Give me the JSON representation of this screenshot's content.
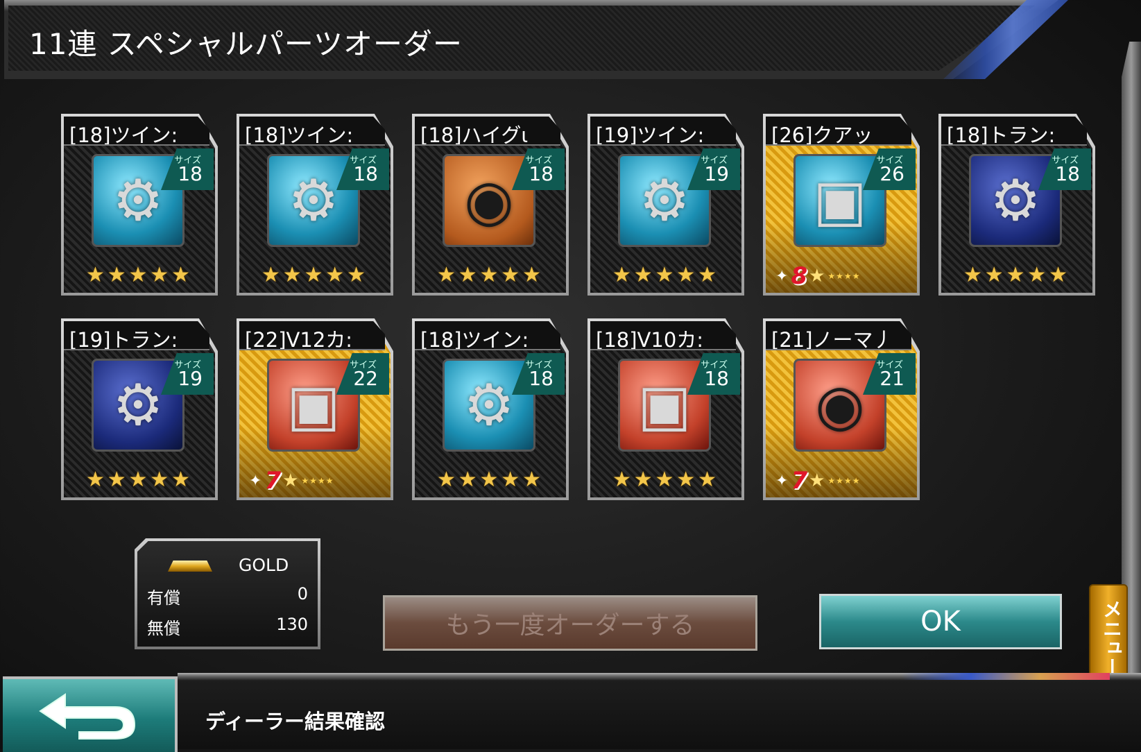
{
  "header": {
    "title": "11連 スペシャルパーツオーダー"
  },
  "parts": [
    {
      "name": "[18]ツイン:",
      "size_label": "サイズ",
      "size": "18",
      "thumb": "twin-turbo-icon",
      "bg": "teal",
      "rarity": "stars",
      "stars": 5
    },
    {
      "name": "[18]ツイン:",
      "size_label": "サイズ",
      "size": "18",
      "thumb": "twin-turbo-icon",
      "bg": "teal",
      "rarity": "stars",
      "stars": 5
    },
    {
      "name": "[18]ハイグι",
      "size_label": "サイズ",
      "size": "18",
      "thumb": "tire-icon",
      "bg": "orange",
      "rarity": "stars",
      "stars": 5
    },
    {
      "name": "[19]ツイン:",
      "size_label": "サイズ",
      "size": "19",
      "thumb": "twin-turbo-icon",
      "bg": "teal",
      "rarity": "stars",
      "stars": 5
    },
    {
      "name": "[26]クアッ",
      "size_label": "サイズ",
      "size": "26",
      "thumb": "engine-icon",
      "bg": "teal",
      "rarity": "rank",
      "rank": "8",
      "gold": true
    },
    {
      "name": "[18]トラン:",
      "size_label": "サイズ",
      "size": "18",
      "thumb": "transmission-icon",
      "bg": "navy",
      "rarity": "stars",
      "stars": 5
    },
    {
      "name": "[19]トラン:",
      "size_label": "サイズ",
      "size": "19",
      "thumb": "transmission-icon",
      "bg": "navy",
      "rarity": "stars",
      "stars": 5
    },
    {
      "name": "[22]V12カ:",
      "size_label": "サイズ",
      "size": "22",
      "thumb": "engine-icon",
      "bg": "red",
      "rarity": "rank",
      "rank": "7",
      "gold": true
    },
    {
      "name": "[18]ツイン:",
      "size_label": "サイズ",
      "size": "18",
      "thumb": "twin-turbo-icon",
      "bg": "teal",
      "rarity": "stars",
      "stars": 5
    },
    {
      "name": "[18]V10カ:",
      "size_label": "サイズ",
      "size": "18",
      "thumb": "engine-icon",
      "bg": "red",
      "rarity": "stars",
      "stars": 5
    },
    {
      "name": "[21]ノーマ丿",
      "size_label": "サイズ",
      "size": "21",
      "thumb": "tire-icon",
      "bg": "red",
      "rarity": "rank",
      "rank": "7",
      "gold": true
    }
  ],
  "gold": {
    "title": "GOLD",
    "paid_label": "有償",
    "paid_value": "0",
    "free_label": "無償",
    "free_value": "130"
  },
  "buttons": {
    "retry_label": "もう一度オーダーする",
    "ok_label": "OK",
    "menu_label": "メニュー",
    "menu_arrows": "◀▶"
  },
  "footer": {
    "screen_title": "ディーラー結果確認"
  },
  "colors": {
    "accent_teal": "#2c8a8b",
    "gold": "#f2c23c",
    "blue_stripe": "#2f4fa8"
  }
}
